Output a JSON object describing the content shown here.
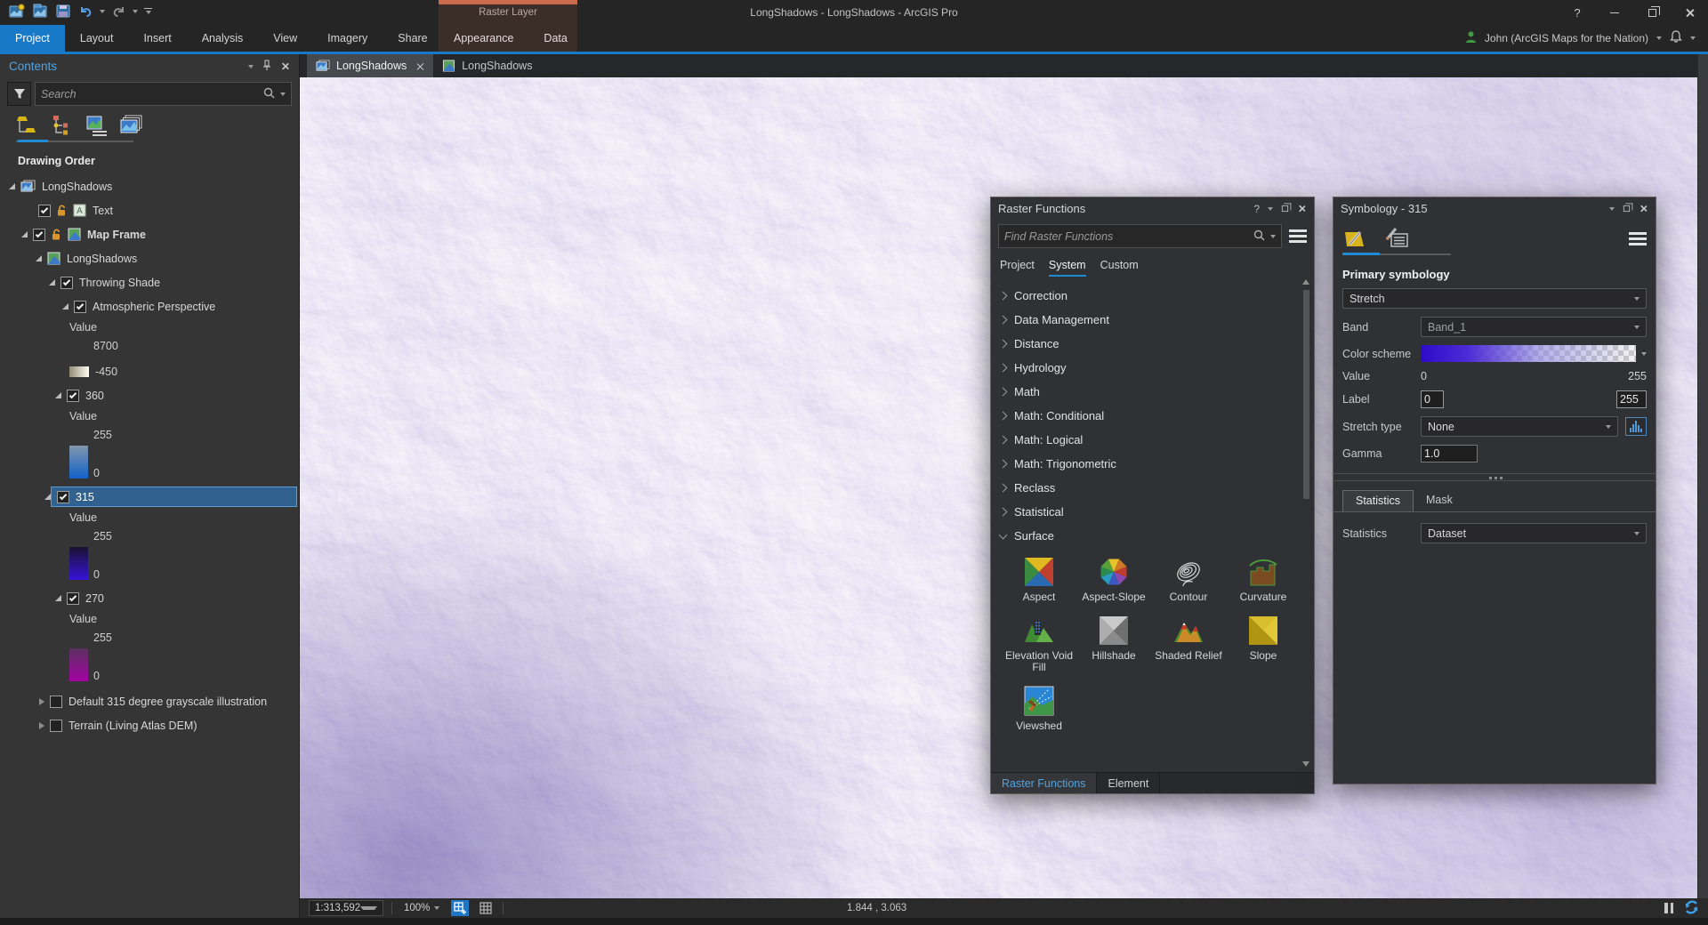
{
  "titlebar": {
    "title": "LongShadows - LongShadows - ArcGIS Pro",
    "help": "?"
  },
  "ribbon": {
    "tabs": [
      "Project",
      "Layout",
      "Insert",
      "Analysis",
      "View",
      "Imagery",
      "Share"
    ],
    "contextual": {
      "group": "Raster Layer",
      "tabs": [
        "Appearance",
        "Data"
      ]
    },
    "user": "John (ArcGIS Maps for the Nation)"
  },
  "contents": {
    "title": "Contents",
    "search_placeholder": "Search",
    "heading": "Drawing Order",
    "tree": {
      "layout_label": "LongShadows",
      "text_label": "Text",
      "text_icon": "A",
      "map_frame_label": "Map Frame",
      "map_label": "LongShadows",
      "group_label": "Throwing Shade",
      "atmos": {
        "label": "Atmospheric Perspective",
        "value": "Value",
        "max": "8700",
        "min": "-450"
      },
      "d360": {
        "label": "360",
        "value": "Value",
        "max": "255",
        "min": "0"
      },
      "d315": {
        "label": "315",
        "value": "Value",
        "max": "255",
        "min": "0"
      },
      "d270": {
        "label": "270",
        "value": "Value",
        "max": "255",
        "min": "0"
      },
      "default315_label": "Default 315 degree grayscale illustration",
      "terrain_label": "Terrain (Living Atlas DEM)"
    }
  },
  "view_tabs": {
    "tab1": "LongShadows",
    "tab2": "LongShadows"
  },
  "raster_functions": {
    "title": "Raster Functions",
    "help": "?",
    "search_placeholder": "Find Raster Functions",
    "tabs": [
      "Project",
      "System",
      "Custom"
    ],
    "categories": [
      "Correction",
      "Data Management",
      "Distance",
      "Hydrology",
      "Math",
      "Math: Conditional",
      "Math: Logical",
      "Math: Trigonometric",
      "Reclass",
      "Statistical"
    ],
    "expanded_category": "Surface",
    "functions": [
      "Aspect",
      "Aspect-Slope",
      "Contour",
      "Curvature",
      "Elevation Void Fill",
      "Hillshade",
      "Shaded Relief",
      "Slope",
      "Viewshed"
    ],
    "bottom_tabs": [
      "Raster Functions",
      "Element"
    ]
  },
  "symbology": {
    "title": "Symbology - 315",
    "heading": "Primary symbology",
    "primary_value": "Stretch",
    "band_label": "Band",
    "band_value": "Band_1",
    "color_scheme_label": "Color scheme",
    "value_label": "Value",
    "value_min": "0",
    "value_max": "255",
    "label_label": "Label",
    "label_min": "0",
    "label_max": "255",
    "stretch_type_label": "Stretch type",
    "stretch_type_value": "None",
    "gamma_label": "Gamma",
    "gamma_value": "1.0",
    "tabs": [
      "Statistics",
      "Mask"
    ],
    "statistics_label": "Statistics",
    "statistics_value": "Dataset"
  },
  "statusbar": {
    "scale": "1:313,592",
    "zoom": "100%",
    "coordinates": "1.844 , 3.063"
  },
  "colors": {
    "accent": "#1779c7",
    "contextual_strip": "#c96a4a",
    "selection": "#31618f",
    "link": "#4fa3e0"
  }
}
